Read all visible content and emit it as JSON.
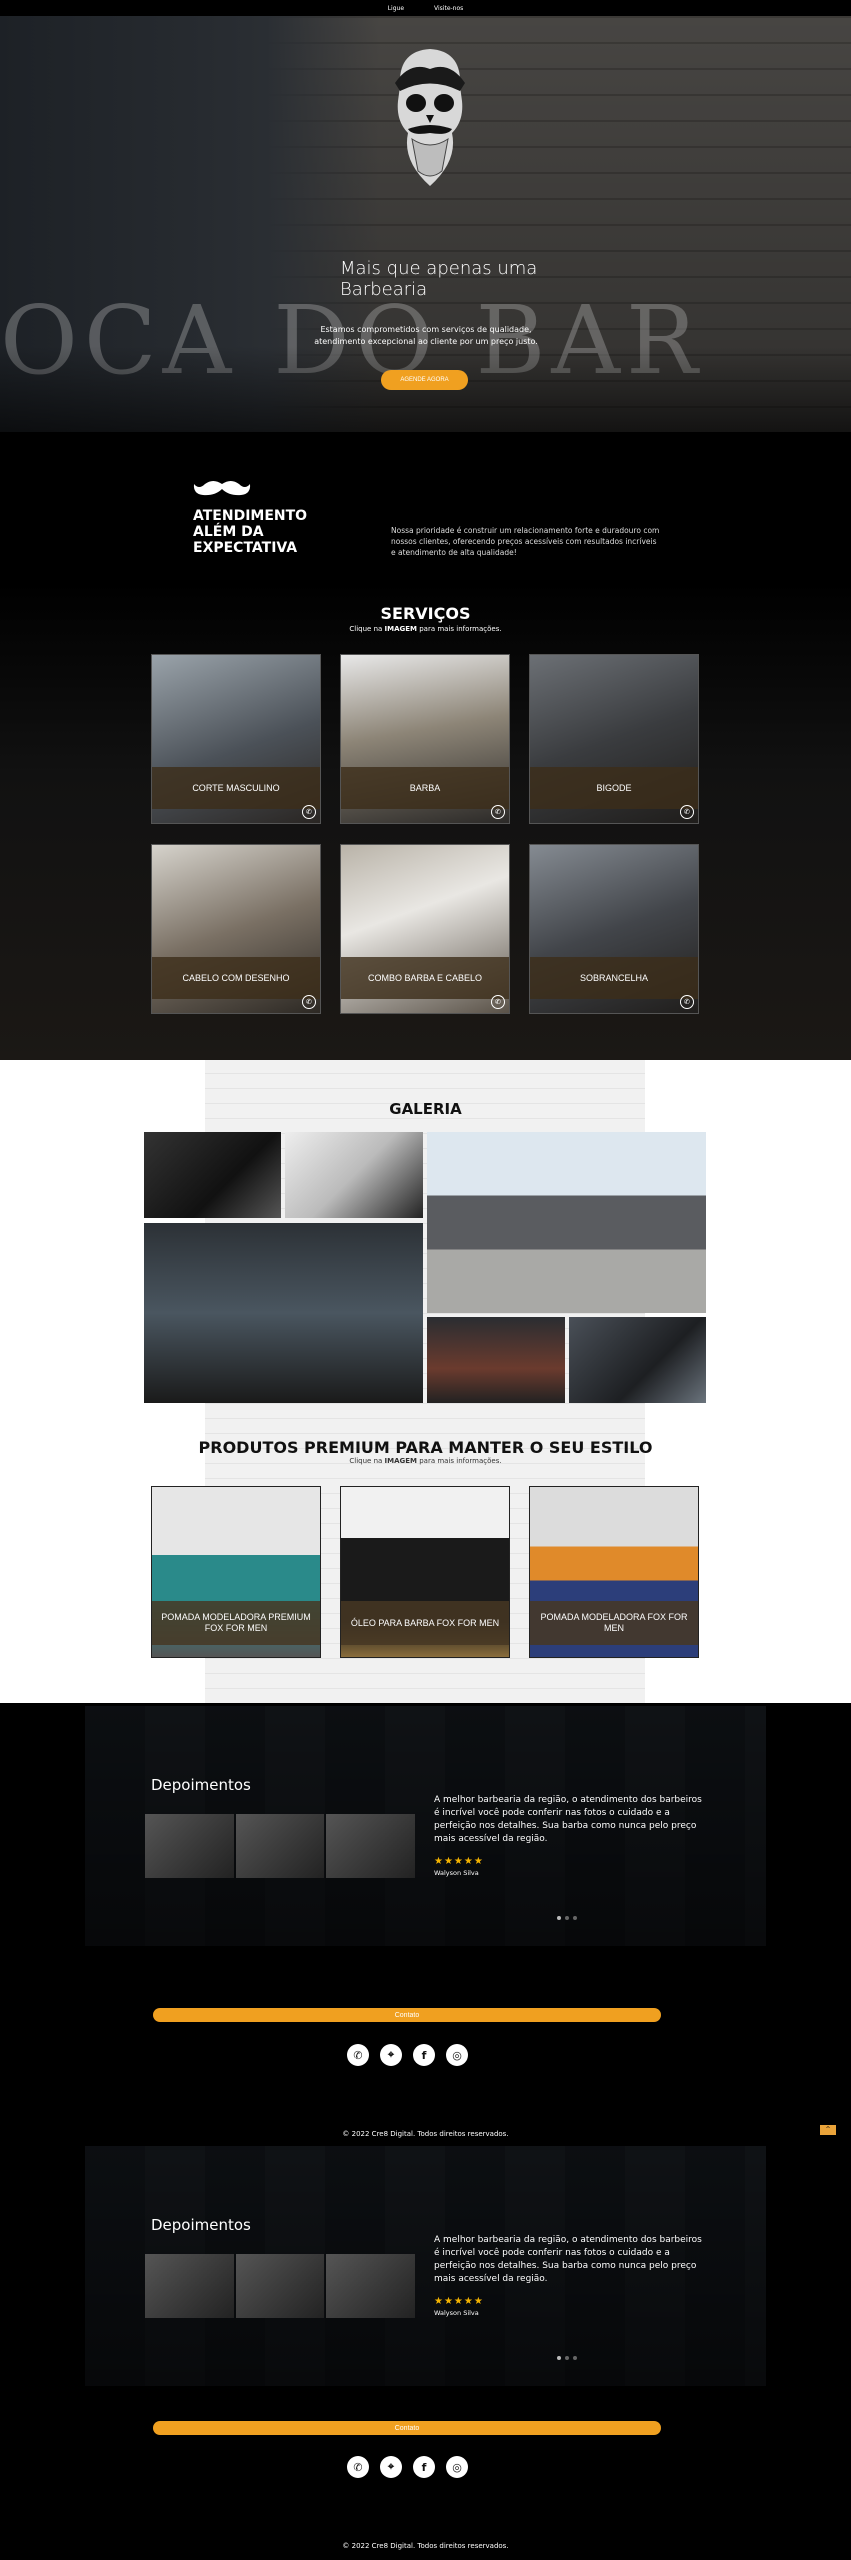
{
  "topbar": {
    "items": [
      "Ligue",
      "Visite-nos"
    ]
  },
  "hero": {
    "title": "Mais que apenas uma Barbearia",
    "bg_text": "OCA DO BAR",
    "description": "Estamos comprometidos com serviços de qualidade, atendimento excepcional ao cliente por um preço justo.",
    "cta": "AGENDE AGORA"
  },
  "intro": {
    "heading": "ATENDIMENTO ALÉM DA EXPECTATIVA",
    "text": "Nossa prioridade é construir um relacionamento forte e duradouro com nossos clientes, oferecendo preços acessíveis com resultados incríveis e atendimento de alta qualidade!"
  },
  "services": {
    "title": "SERVIÇOS",
    "subtitle_pre": "Clique na ",
    "subtitle_bold": "IMAGEM",
    "subtitle_post": " para mais informações.",
    "items": [
      "CORTE MASCULINO",
      "BARBA",
      "BIGODE",
      "CABELO COM DESENHO",
      "COMBO BARBA E CABELO",
      "SOBRANCELHA"
    ]
  },
  "gallery": {
    "title": "GALERIA"
  },
  "products": {
    "title": "PRODUTOS PREMIUM PARA MANTER O SEU ESTILO",
    "subtitle_pre": "Clique na ",
    "subtitle_bold": "IMAGEM",
    "subtitle_post": " para mais informações.",
    "items": [
      "POMADA MODELADORA PREMIUM FOX FOR MEN",
      "ÓLEO PARA BARBA FOX FOR MEN",
      "POMADA MODELADORA FOX FOR MEN"
    ]
  },
  "testimonials": [
    {
      "title": "Depoimentos",
      "quote": "A melhor barbearia da região, o atendimento dos barbeiros é incrível você pode conferir nas fotos o cuidado e a perfeição nos detalhes. Sua barba como nunca pelo preço mais acessível da região.",
      "stars": "★★★★★",
      "author": "Walyson Silva"
    },
    {
      "title": "Depoimentos",
      "quote": "A melhor barbearia da região, o atendimento dos barbeiros é incrível você pode conferir nas fotos o cuidado e a perfeição nos detalhes. Sua barba como nunca pelo preço mais acessível da região.",
      "stars": "★★★★★",
      "author": "Walyson Silva"
    }
  ],
  "footer": {
    "contact": "Contato",
    "copyright": "© 2022 Cre8 Digital. Todos direitos reservados.",
    "socials": [
      "whatsapp-icon",
      "location-icon",
      "facebook-icon",
      "instagram-icon"
    ],
    "scroll_top": "^"
  },
  "colors": {
    "accent": "#f0a020",
    "card_label": "#3c2d19"
  }
}
